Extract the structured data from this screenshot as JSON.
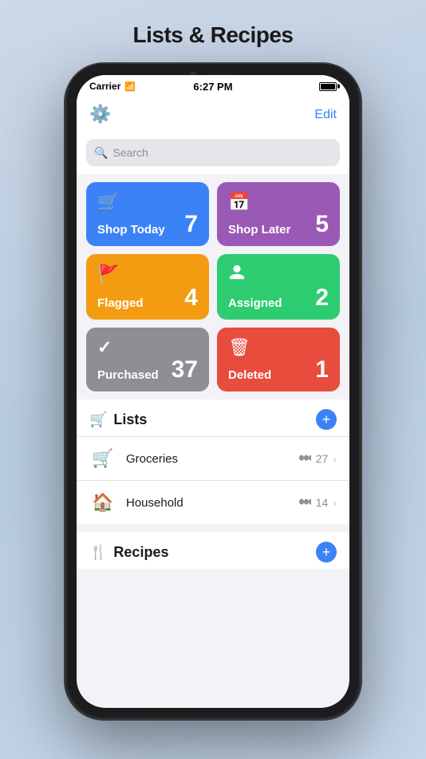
{
  "page": {
    "title": "Lists & Recipes"
  },
  "statusBar": {
    "carrier": "Carrier",
    "time": "6:27 PM"
  },
  "header": {
    "editLabel": "Edit"
  },
  "search": {
    "placeholder": "Search"
  },
  "cards": [
    {
      "id": "shop-today",
      "label": "Shop Today",
      "count": "7",
      "icon": "🛒",
      "colorClass": "card-shop-today"
    },
    {
      "id": "shop-later",
      "label": "Shop Later",
      "count": "5",
      "icon": "📅",
      "colorClass": "card-shop-later"
    },
    {
      "id": "flagged",
      "label": "Flagged",
      "count": "4",
      "icon": "🚩",
      "colorClass": "card-flagged"
    },
    {
      "id": "assigned",
      "label": "Assigned",
      "count": "2",
      "icon": "👤",
      "colorClass": "card-assigned"
    },
    {
      "id": "purchased",
      "label": "Purchased",
      "count": "37",
      "icon": "✓",
      "colorClass": "card-purchased"
    },
    {
      "id": "deleted",
      "label": "Deleted",
      "count": "1",
      "icon": "🗑",
      "colorClass": "card-deleted"
    }
  ],
  "lists": {
    "title": "Lists",
    "addLabel": "+",
    "items": [
      {
        "id": "groceries",
        "icon": "🛒",
        "name": "Groceries",
        "count": "27"
      },
      {
        "id": "household",
        "icon": "🏠",
        "name": "Household",
        "count": "14"
      }
    ]
  },
  "recipes": {
    "title": "Recipes",
    "addLabel": "+"
  }
}
